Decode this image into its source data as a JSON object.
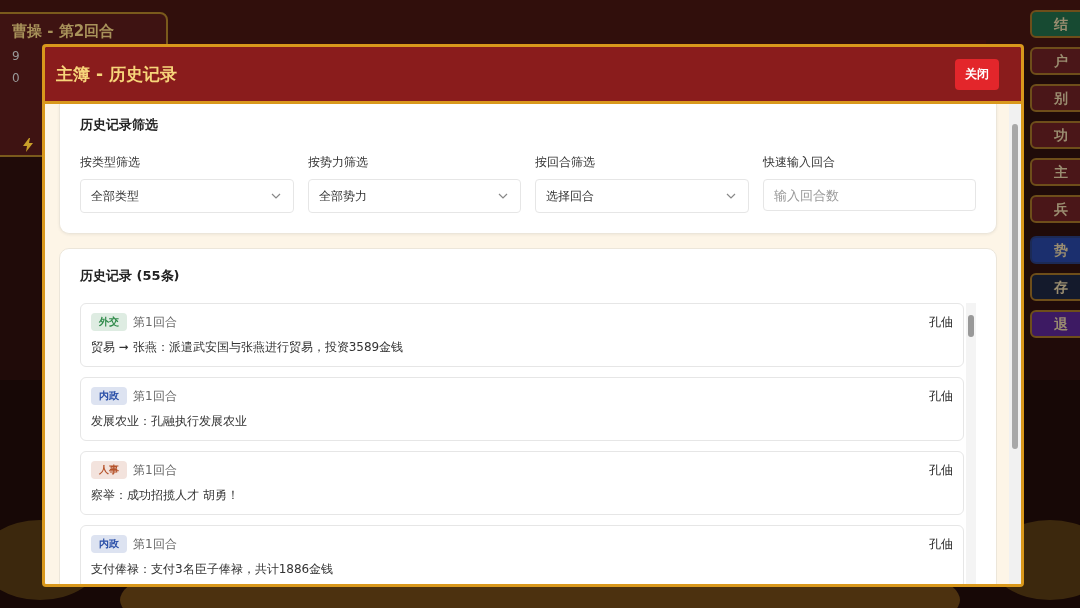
{
  "status_panel": {
    "title": "曹操 - 第2回合",
    "lines": [
      "9",
      "0"
    ]
  },
  "side_buttons": [
    {
      "label": "结",
      "color": "#174a32"
    },
    {
      "label": "户",
      "color": "#4a1618"
    },
    {
      "label": "别",
      "color": "#4a1618"
    },
    {
      "label": "功",
      "color": "#4a1618"
    },
    {
      "label": "主",
      "color": "#4a1618"
    },
    {
      "label": "兵",
      "color": "#4a1618"
    },
    {
      "label": "势",
      "color": "#1b2f6e"
    },
    {
      "label": "存",
      "color": "#141a2c"
    },
    {
      "label": "退",
      "color": "#3d1a63"
    }
  ],
  "modal": {
    "title": "主簿 - 历史记录",
    "close_button": "关闭",
    "filter_card": {
      "title": "历史记录筛选",
      "filters": [
        {
          "kind": "select",
          "label": "按类型筛选",
          "value": "全部类型"
        },
        {
          "kind": "select",
          "label": "按势力筛选",
          "value": "全部势力"
        },
        {
          "kind": "select",
          "label": "按回合筛选",
          "value": "选择回合"
        },
        {
          "kind": "input",
          "label": "快速输入回合",
          "placeholder": "输入回合数"
        }
      ]
    },
    "history": {
      "title": "历史记录 (55条)",
      "records": [
        {
          "type": "外交",
          "color": "#2f8a4a",
          "round": "第1回合",
          "faction": "孔伷",
          "text": "贸易 ➞ 张燕：派遣武安国与张燕进行贸易，投资3589金钱"
        },
        {
          "type": "内政",
          "color": "#2a4fa8",
          "round": "第1回合",
          "faction": "孔伷",
          "text": "发展农业：孔融执行发展农业"
        },
        {
          "type": "人事",
          "color": "#b5522a",
          "round": "第1回合",
          "faction": "孔伷",
          "text": "察举：成功招揽人才 胡勇！"
        },
        {
          "type": "内政",
          "color": "#2a4fa8",
          "round": "第1回合",
          "faction": "孔伷",
          "text": "支付俸禄：支付3名臣子俸禄，共计1886金钱"
        }
      ]
    }
  }
}
